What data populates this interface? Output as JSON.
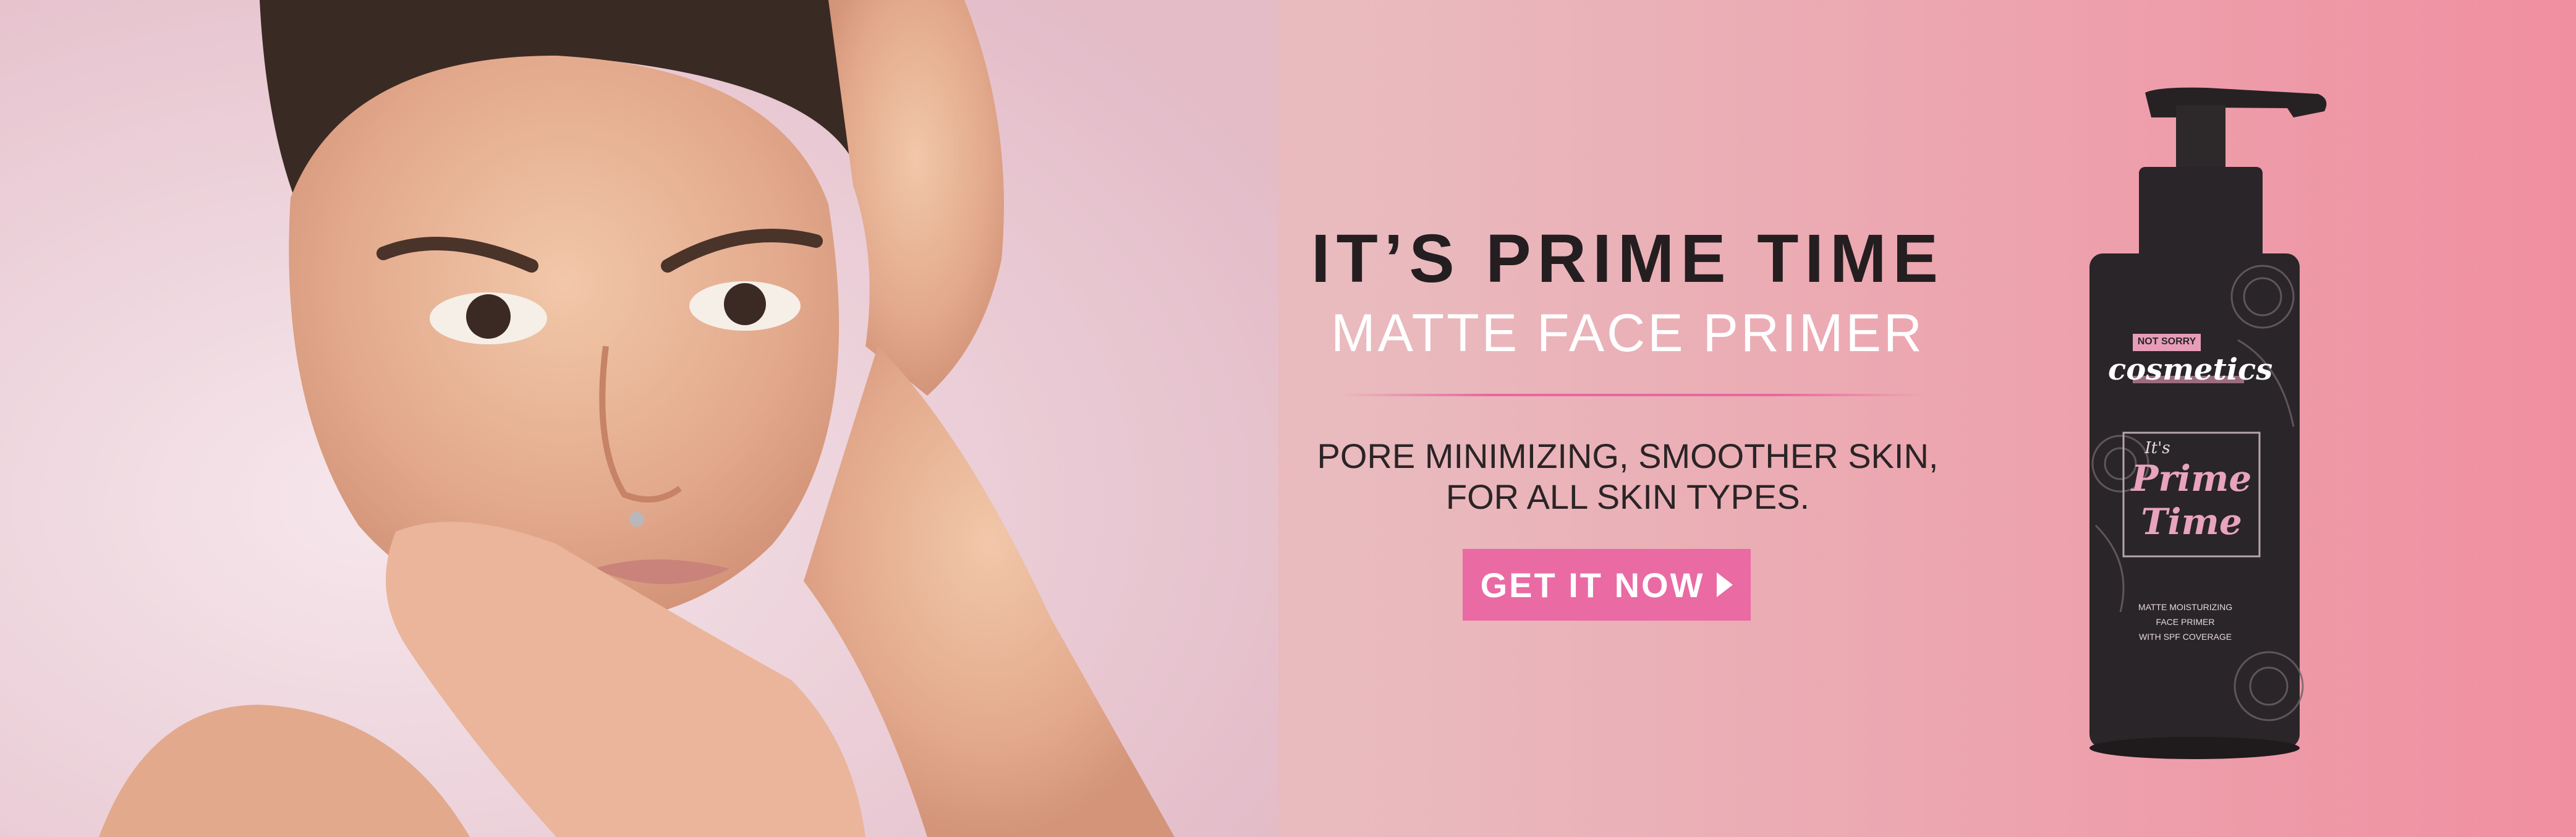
{
  "headline": "IT’S PRIME TIME",
  "subheadline": "MATTE FACE PRIMER",
  "description_lines": [
    "PORE MINIMIZING, SMOOTHER SKIN,",
    "FOR ALL SKIN TYPES."
  ],
  "cta": {
    "label": "GET IT NOW",
    "icon": "play-arrow-icon"
  },
  "product": {
    "brand_tag": "NOT SORRY",
    "brand_name": "cosmetics",
    "product_script_small": "It's",
    "product_script_line1": "Prime",
    "product_script_line2": "Time",
    "details": [
      "MATTE MOISTURIZING",
      "FACE PRIMER",
      "WITH SPF COVERAGE"
    ]
  },
  "colors": {
    "accent_pink": "#ea6aa4",
    "headline_dark": "#241e20",
    "bottle_black": "#2a2528"
  }
}
